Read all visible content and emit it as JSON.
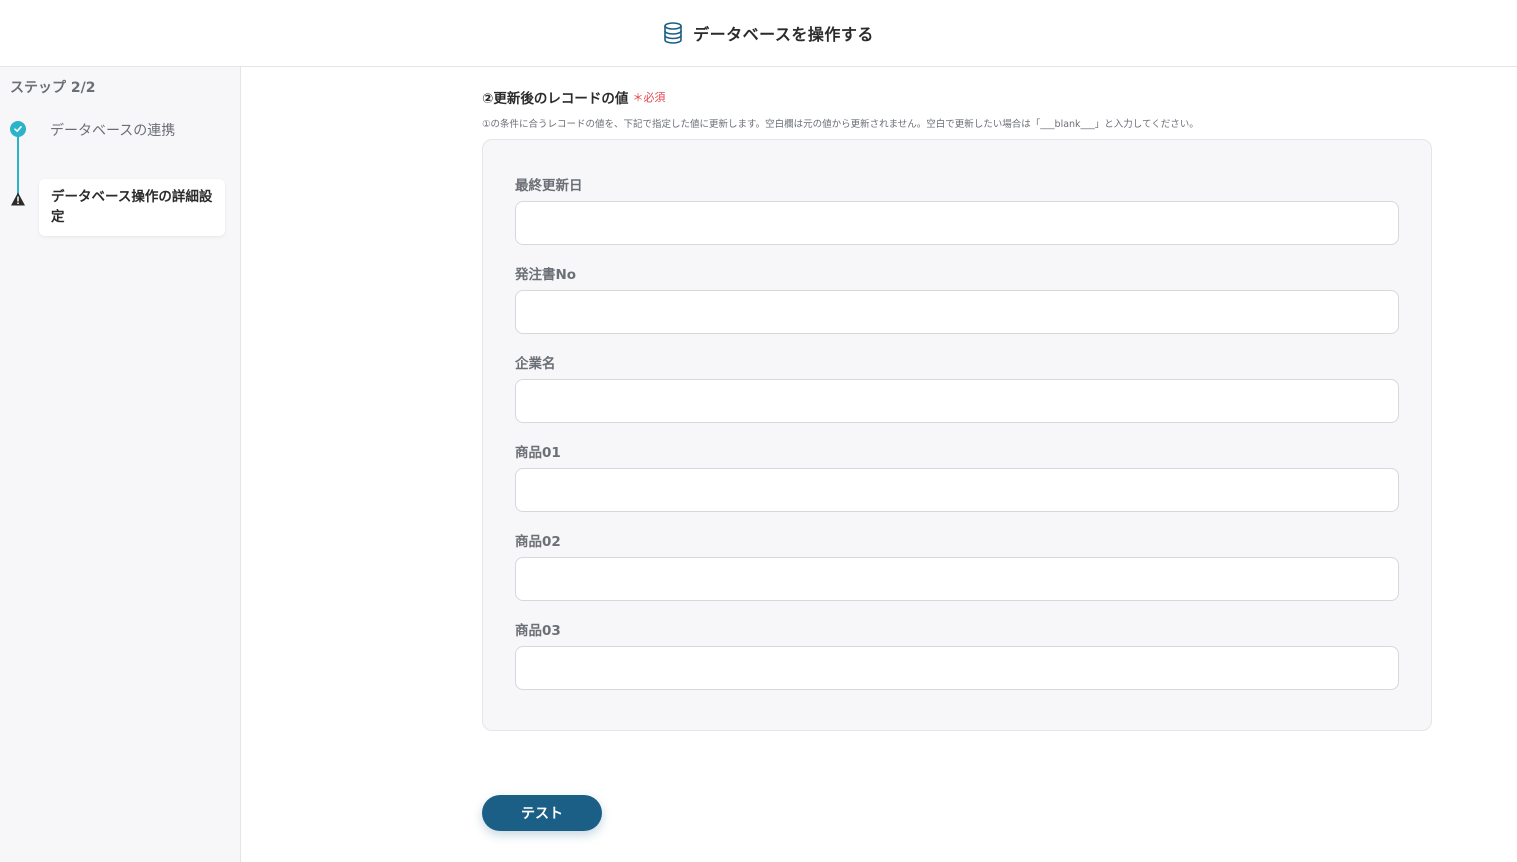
{
  "header": {
    "title": "データベースを操作する",
    "icon": "database-icon"
  },
  "sidebar": {
    "step_label": "ステップ 2/2",
    "steps": [
      {
        "label": "データベースの連携",
        "status": "completed",
        "icon": "check-icon"
      },
      {
        "label": "データベース操作の詳細設定",
        "status": "warning",
        "icon": "warning-icon"
      }
    ]
  },
  "section": {
    "title": "②更新後のレコードの値",
    "required_mark": "＊",
    "required_label": "必須",
    "description": "①の条件に合うレコードの値を、下記で指定した値に更新します。空白欄は元の値から更新されません。空白で更新したい場合は「___blank___」と入力してください。"
  },
  "fields": [
    {
      "label": "最終更新日",
      "value": ""
    },
    {
      "label": "発注書No",
      "value": ""
    },
    {
      "label": "企業名",
      "value": ""
    },
    {
      "label": "商品01",
      "value": ""
    },
    {
      "label": "商品02",
      "value": ""
    },
    {
      "label": "商品03",
      "value": ""
    }
  ],
  "actions": {
    "test_label": "テスト"
  },
  "colors": {
    "accent": "#2bb3c9",
    "primary_button": "#1b5f86",
    "required": "#e5484d",
    "warning": "#2b2b2b"
  }
}
